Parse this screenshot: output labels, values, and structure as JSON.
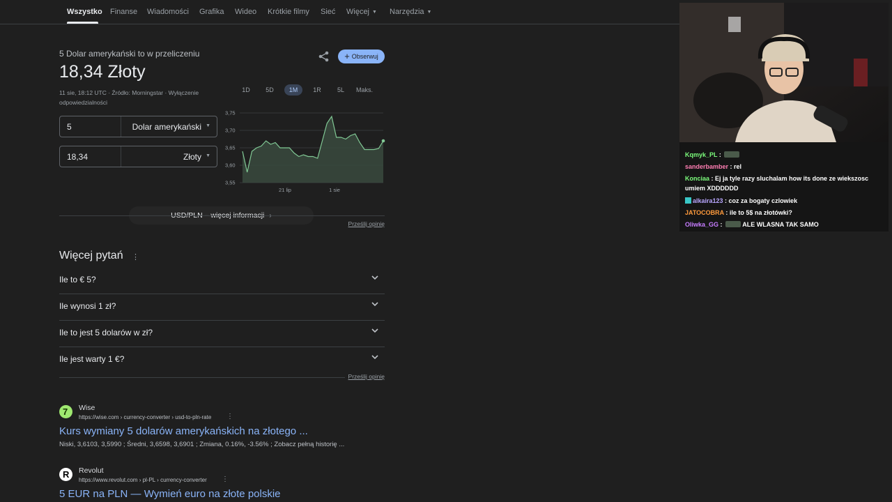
{
  "nav": {
    "items": [
      {
        "label": "Wszystko",
        "active": true
      },
      {
        "label": "Finanse"
      },
      {
        "label": "Wiadomości"
      },
      {
        "label": "Grafika"
      },
      {
        "label": "Wideo"
      },
      {
        "label": "Krótkie filmy"
      },
      {
        "label": "Sieć"
      },
      {
        "label": "Więcej",
        "dropdown": true
      },
      {
        "label": "Narzędzia",
        "dropdown": true
      }
    ]
  },
  "converter": {
    "subtitle": "5 Dolar amerykański to w przeliczeniu",
    "result": "18,34 Złoty",
    "meta_line1": "11 sie, 18:12 UTC · Źródło: Morningstar · Wyłączenie",
    "meta_line2": "odpowiedzialności",
    "follow_label": "Obserwuj",
    "from_amount": "5",
    "from_currency": "Dolar amerykański",
    "to_amount": "18,34",
    "to_currency": "Złoty",
    "more_info": "USD/PLN – więcej informacji",
    "feedback": "Prześlij opinię"
  },
  "ranges": [
    "1D",
    "5D",
    "1M",
    "1R",
    "5L",
    "Maks."
  ],
  "selected_range": "1M",
  "chart_data": {
    "type": "area",
    "yticks": [
      "3,75",
      "3,70",
      "3,65",
      "3,60",
      "3,55"
    ],
    "xticks": [
      "21 lip",
      "1 sie"
    ],
    "ylim": [
      3.55,
      3.75
    ],
    "values": [
      3.64,
      3.58,
      3.64,
      3.65,
      3.655,
      3.67,
      3.66,
      3.665,
      3.65,
      3.65,
      3.65,
      3.635,
      3.625,
      3.63,
      3.625,
      3.625,
      3.62,
      3.67,
      3.72,
      3.74,
      3.68,
      3.68,
      3.675,
      3.685,
      3.69,
      3.665,
      3.645,
      3.645,
      3.645,
      3.648,
      3.67
    ],
    "line_color": "#81c995",
    "grid": true
  },
  "questions": {
    "title": "Więcej pytań",
    "items": [
      "Ile to € 5?",
      "Ile wynosi 1 zł?",
      "Ile to jest 5 dolarów w zł?",
      "Ile jest warty 1 €?"
    ],
    "feedback": "Prześlij opinię"
  },
  "results": [
    {
      "site": "Wise",
      "url": "https://wise.com › currency-converter › usd-to-pln-rate",
      "title": "Kurs wymiany 5 dolarów amerykańskich na złotego ...",
      "snippet": "Niski, 3,6103, 3,5990 ; Średni, 3,6598, 3,6901 ; Zmiana, 0.16%, -3.56% ; Zobacz pełną historię ...",
      "icon_color": "#9fe870",
      "icon_glyph": "7"
    },
    {
      "site": "Revolut",
      "url": "https://www.revolut.com › pl-PL › currency-converter",
      "title": "5 EUR na PLN — Wymień euro na złote polskie",
      "icon_color": "#ffffff",
      "icon_glyph": "R"
    }
  ],
  "chat": [
    {
      "user": "Kqmyk_PL",
      "color": "#7cfc7c",
      "msg": "",
      "emote": true
    },
    {
      "user": "sanderbamber",
      "color": "#ff7eb3",
      "msg": "rel"
    },
    {
      "user": "Konciaa",
      "color": "#7cfc7c",
      "msg": "Ej ja tyle razy sluchalam how its done ze wiekszosc umiem XDDDDDD"
    },
    {
      "user": "alkaira123",
      "color": "#b8a6ff",
      "msg": "coz za bogaty czlowiek",
      "badge": true
    },
    {
      "user": "JATOCOBRA",
      "color": "#ff9a3c",
      "msg": "ile to 5$ na złotówki?"
    },
    {
      "user": "Oliwka_GG",
      "color": "#c77dff",
      "msg": "ALE WLASNA TAK SAMO",
      "emote": true
    }
  ]
}
